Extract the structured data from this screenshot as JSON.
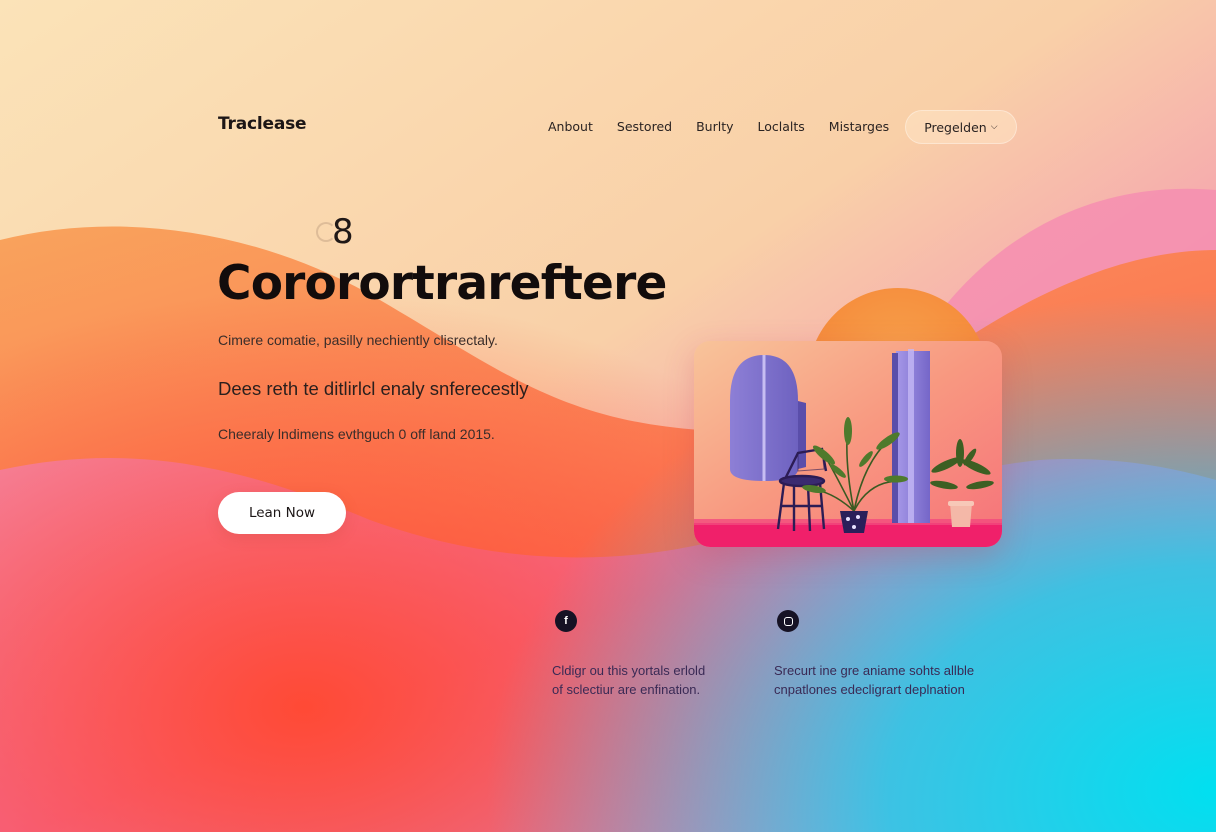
{
  "header": {
    "brand": "Traclease",
    "nav": [
      "Anbout",
      "Sestored",
      "Burlty",
      "Loclalts",
      "Mistarges"
    ],
    "cta_label": "Pregelden",
    "cta_icon": "chevron-down-icon"
  },
  "hero": {
    "badge_number": "8",
    "headline": "Cororortrareftere",
    "subtitle_1": "Cimere comatie, pasilly nechiently clisrectaly.",
    "subtitle_2": "Dees reth te ditlirlcl enaly snferecestly",
    "subtitle_3": "Cheeraly lndimens evthguch 0 off land 2015.",
    "button_label": "Lean Now"
  },
  "features": [
    {
      "icon": "facebook-icon",
      "icon_glyph": "f",
      "line1": "Cldigr ou this yortals erlold",
      "line2": "of sclectiur are enfination."
    },
    {
      "icon": "instagram-icon",
      "line1": "Srecurt ine gre aniame sohts allble",
      "line2": "cnpatlones edecligrart deplnation"
    }
  ],
  "colors": {
    "peach": "#f9d8ae",
    "orange": "#ff6b3d",
    "pink": "#f46a9b",
    "cyan": "#0fd6e8",
    "sun": "#f58a3a",
    "text_dark": "#120c0c",
    "icon_bg": "#161224"
  }
}
